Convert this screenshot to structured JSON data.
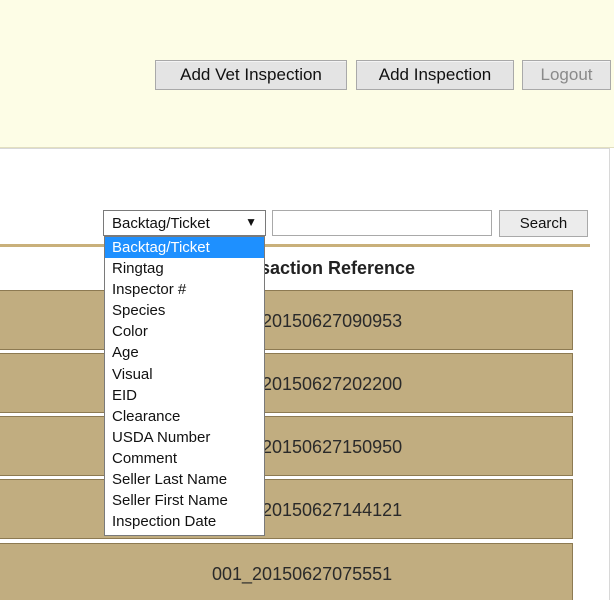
{
  "header": {
    "buttons": [
      {
        "label": "Add Vet Inspection"
      },
      {
        "label": "Add Inspection"
      },
      {
        "label": "Logout"
      }
    ]
  },
  "search": {
    "field_selected": "Backtag/Ticket",
    "button_label": "Search",
    "input_value": ""
  },
  "dropdown": {
    "options": [
      "Backtag/Ticket",
      "Ringtag",
      "Inspector #",
      "Species",
      "Color",
      "Age",
      "Visual",
      "EID",
      "Clearance",
      "USDA Number",
      "Comment",
      "Seller Last Name",
      "Seller First Name",
      "Inspection Date"
    ],
    "selected_index": 0
  },
  "table": {
    "column_header": "saction Reference",
    "rows": [
      {
        "reference": "20150627090953"
      },
      {
        "reference": "20150627202200"
      },
      {
        "reference": "20150627150950"
      },
      {
        "reference": "20150627144121"
      },
      {
        "reference": "001_20150627075551"
      }
    ]
  },
  "colors": {
    "header_bg": "#fdfde6",
    "row_bg": "#c1ad80",
    "accent_line": "#c9b07a",
    "selected_option": "#1e90ff"
  }
}
